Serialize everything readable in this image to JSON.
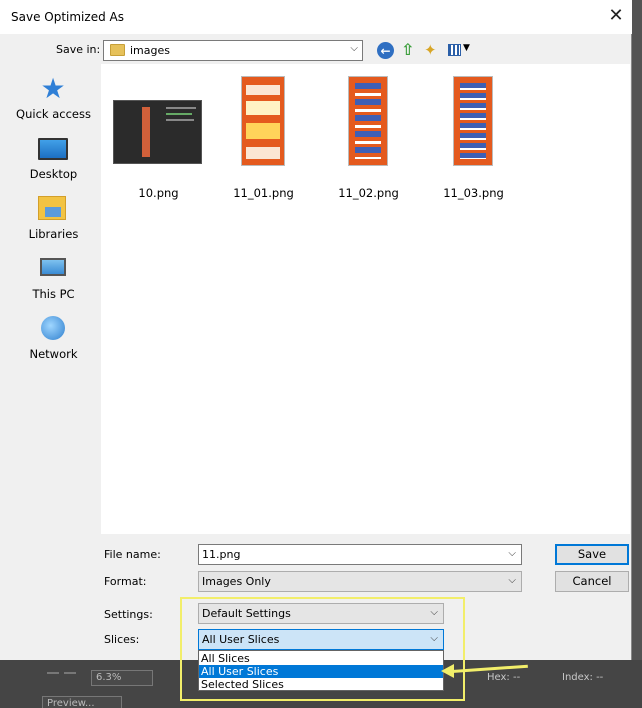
{
  "window": {
    "title": "Save Optimized As"
  },
  "toolbar": {
    "save_in_label": "Save in:",
    "save_in_value": "images",
    "icons": [
      "back-icon",
      "up-folder-icon",
      "new-folder-icon",
      "view-menu-icon"
    ]
  },
  "places": [
    {
      "label": "Quick access",
      "icon": "star-icon"
    },
    {
      "label": "Desktop",
      "icon": "desktop-icon"
    },
    {
      "label": "Libraries",
      "icon": "libraries-icon"
    },
    {
      "label": "This PC",
      "icon": "computer-icon"
    },
    {
      "label": "Network",
      "icon": "network-icon"
    }
  ],
  "files": [
    {
      "name": "10.png"
    },
    {
      "name": "11_01.png"
    },
    {
      "name": "11_02.png"
    },
    {
      "name": "11_03.png"
    }
  ],
  "form": {
    "file_name_label": "File name:",
    "file_name_value": "11.png",
    "format_label": "Format:",
    "format_value": "Images Only",
    "settings_label": "Settings:",
    "settings_value": "Default Settings",
    "slices_label": "Slices:",
    "slices_value": "All User Slices",
    "slices_options": [
      "All Slices",
      "All User Slices",
      "Selected Slices"
    ],
    "slices_selected": "All User Slices"
  },
  "buttons": {
    "save": "Save",
    "cancel": "Cancel"
  },
  "background_app": {
    "zoom": "6.3%",
    "hex_label": "Hex: --",
    "index_label": "Index: --",
    "preview_label": "Preview..."
  },
  "colors": {
    "accent": "#0078d7",
    "highlight": "#f2ee6a"
  }
}
